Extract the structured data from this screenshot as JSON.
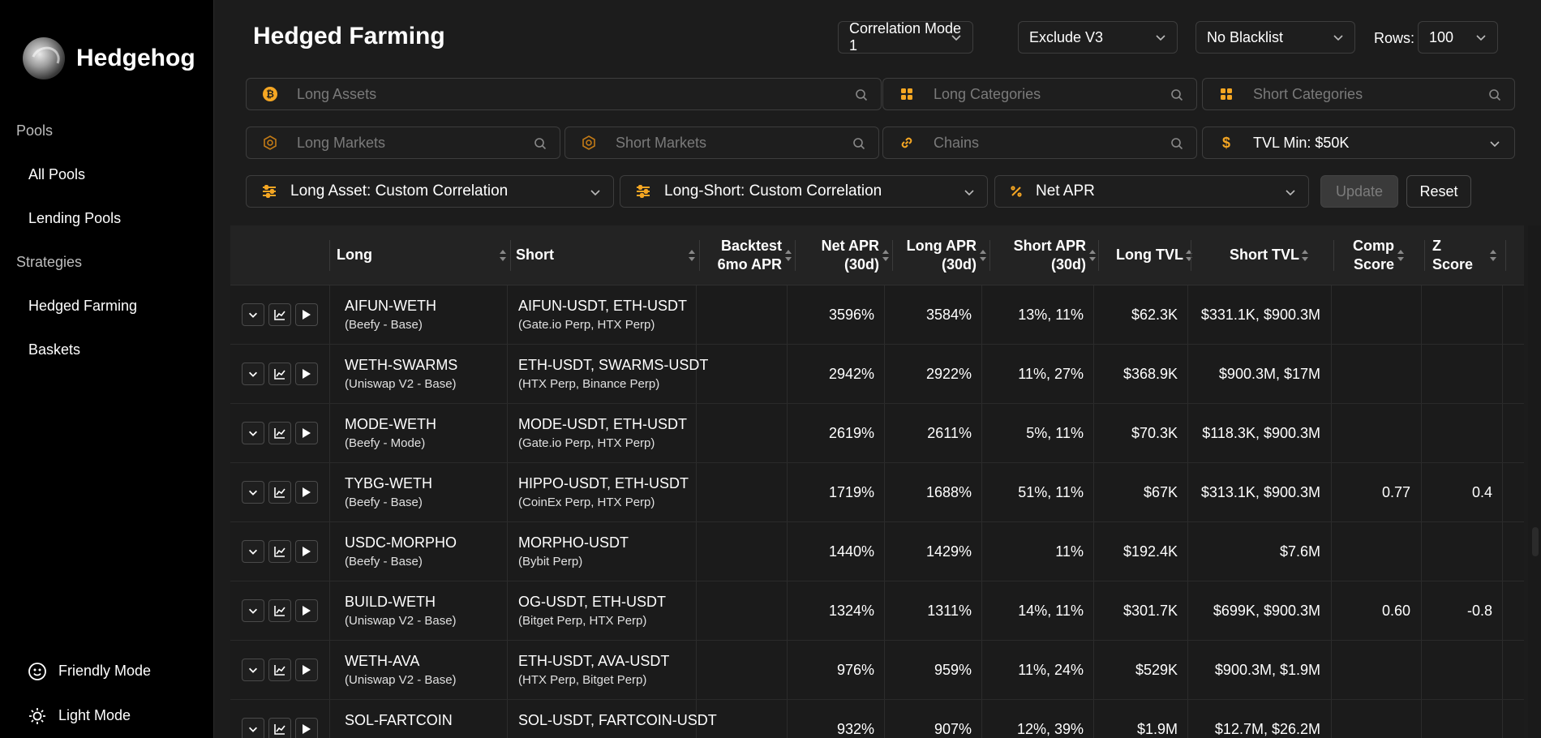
{
  "brand": {
    "name": "Hedgehog"
  },
  "sidebar": {
    "sections": [
      {
        "label": "Pools",
        "items": [
          {
            "label": "All Pools"
          },
          {
            "label": "Lending Pools"
          }
        ]
      },
      {
        "label": "Strategies",
        "items": [
          {
            "label": "Hedged Farming"
          },
          {
            "label": "Baskets"
          }
        ]
      }
    ],
    "bottom": [
      {
        "label": "Friendly Mode",
        "icon": "smile-icon"
      },
      {
        "label": "Light Mode",
        "icon": "sun-icon"
      }
    ]
  },
  "header": {
    "title": "Hedged Farming",
    "correlation_mode": "Correlation Mode 1",
    "exclude": "Exclude V3",
    "blacklist": "No Blacklist",
    "rows_label": "Rows:",
    "rows_value": "100"
  },
  "filters": {
    "long_assets": "Long Assets",
    "long_categories": "Long Categories",
    "short_categories": "Short Categories",
    "long_markets": "Long Markets",
    "short_markets": "Short Markets",
    "chains": "Chains",
    "tvl_min": "TVL Min: $50K"
  },
  "controls": {
    "long_asset_corr": "Long Asset: Custom Correlation",
    "long_short_corr": "Long-Short: Custom Correlation",
    "sort_metric": "Net APR",
    "update": "Update",
    "reset": "Reset"
  },
  "colors": {
    "accent": "#f5a623",
    "bg": "#1c1c1c",
    "sidebar": "#000000"
  },
  "table": {
    "headers": {
      "long": "Long",
      "short": "Short",
      "backtest_1": "Backtest",
      "backtest_2": "6mo APR",
      "net_apr_1": "Net APR",
      "net_apr_2": "(30d)",
      "long_apr_1": "Long APR",
      "long_apr_2": "(30d)",
      "short_apr_1": "Short APR",
      "short_apr_2": "(30d)",
      "long_tvl": "Long TVL",
      "short_tvl": "Short TVL",
      "comp_1": "Comp",
      "comp_2": "Score",
      "z_score": "Z Score"
    },
    "rows": [
      {
        "long": "AIFUN-WETH",
        "long_sub": "(Beefy - Base)",
        "short": "AIFUN-USDT, ETH-USDT",
        "short_sub": "(Gate.io Perp, HTX Perp)",
        "backtest": "",
        "net_apr": "3596%",
        "long_apr": "3584%",
        "short_apr": "13%, 11%",
        "long_tvl": "$62.3K",
        "short_tvl": "$331.1K, $900.3M",
        "comp": "",
        "z": ""
      },
      {
        "long": "WETH-SWARMS",
        "long_sub": "(Uniswap V2 - Base)",
        "short": "ETH-USDT, SWARMS-USDT",
        "short_sub": "(HTX Perp, Binance Perp)",
        "backtest": "",
        "net_apr": "2942%",
        "long_apr": "2922%",
        "short_apr": "11%, 27%",
        "long_tvl": "$368.9K",
        "short_tvl": "$900.3M, $17M",
        "comp": "",
        "z": ""
      },
      {
        "long": "MODE-WETH",
        "long_sub": "(Beefy - Mode)",
        "short": "MODE-USDT, ETH-USDT",
        "short_sub": "(Gate.io Perp, HTX Perp)",
        "backtest": "",
        "net_apr": "2619%",
        "long_apr": "2611%",
        "short_apr": "5%, 11%",
        "long_tvl": "$70.3K",
        "short_tvl": "$118.3K, $900.3M",
        "comp": "",
        "z": ""
      },
      {
        "long": "TYBG-WETH",
        "long_sub": "(Beefy - Base)",
        "short": "HIPPO-USDT, ETH-USDT",
        "short_sub": "(CoinEx Perp, HTX Perp)",
        "backtest": "",
        "net_apr": "1719%",
        "long_apr": "1688%",
        "short_apr": "51%, 11%",
        "long_tvl": "$67K",
        "short_tvl": "$313.1K, $900.3M",
        "comp": "0.77",
        "z": "0.4"
      },
      {
        "long": "USDC-MORPHO",
        "long_sub": "(Beefy - Base)",
        "short": "MORPHO-USDT",
        "short_sub": "(Bybit Perp)",
        "backtest": "",
        "net_apr": "1440%",
        "long_apr": "1429%",
        "short_apr": "11%",
        "long_tvl": "$192.4K",
        "short_tvl": "$7.6M",
        "comp": "",
        "z": ""
      },
      {
        "long": "BUILD-WETH",
        "long_sub": "(Uniswap V2 - Base)",
        "short": "OG-USDT, ETH-USDT",
        "short_sub": "(Bitget Perp, HTX Perp)",
        "backtest": "",
        "net_apr": "1324%",
        "long_apr": "1311%",
        "short_apr": "14%, 11%",
        "long_tvl": "$301.7K",
        "short_tvl": "$699K, $900.3M",
        "comp": "0.60",
        "z": "-0.8"
      },
      {
        "long": "WETH-AVA",
        "long_sub": "(Uniswap V2 - Base)",
        "short": "ETH-USDT, AVA-USDT",
        "short_sub": "(HTX Perp, Bitget Perp)",
        "backtest": "",
        "net_apr": "976%",
        "long_apr": "959%",
        "short_apr": "11%, 24%",
        "long_tvl": "$529K",
        "short_tvl": "$900.3M, $1.9M",
        "comp": "",
        "z": ""
      },
      {
        "long": "SOL-FARTCOIN",
        "long_sub": "",
        "short": "SOL-USDT, FARTCOIN-USDT",
        "short_sub": "",
        "backtest": "",
        "net_apr": "932%",
        "long_apr": "907%",
        "short_apr": "12%, 39%",
        "long_tvl": "$1.9M",
        "short_tvl": "$12.7M, $26.2M",
        "comp": "",
        "z": ""
      }
    ]
  }
}
